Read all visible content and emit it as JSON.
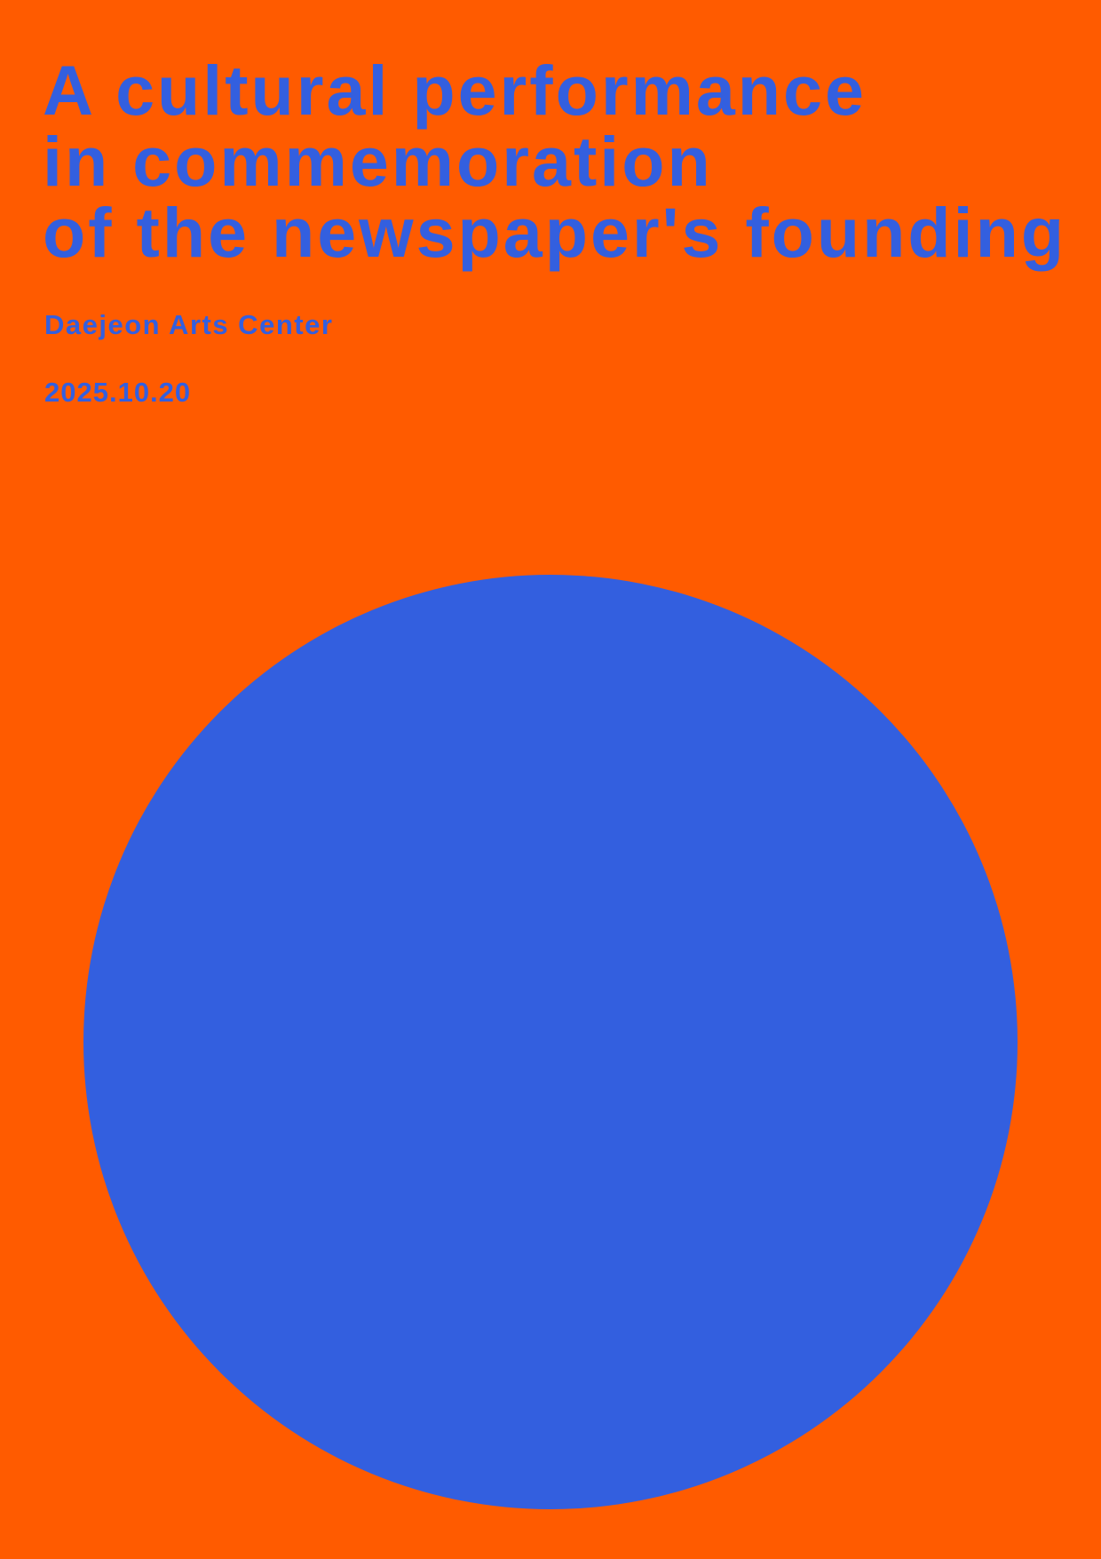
{
  "poster": {
    "title_lines": [
      "A cultural performance",
      "in commemoration",
      "of the newspaper's founding"
    ],
    "venue": "Daejeon Arts Center",
    "date": "2025.10.20"
  },
  "colors": {
    "background": "#FF5B00",
    "accent": "#335FDF"
  }
}
